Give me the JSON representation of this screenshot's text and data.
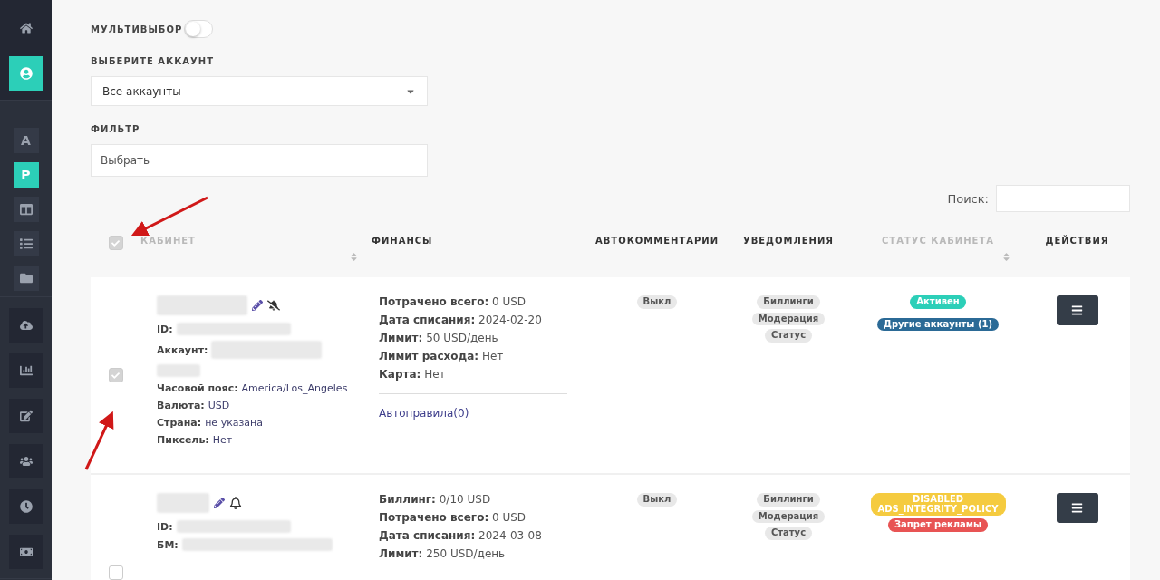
{
  "sidebar": {
    "groups": [
      {
        "kind": "large",
        "items": [
          {
            "selected": false
          },
          {
            "selected": true
          }
        ]
      },
      {
        "kind": "small",
        "items": [
          {
            "letter": "A",
            "selected": false
          },
          {
            "letter": "P",
            "selected": true
          },
          {
            "selected": false
          },
          {
            "selected": false
          },
          {
            "selected": false
          }
        ]
      },
      {
        "kind": "large",
        "items": [
          {
            "selected": false
          },
          {
            "selected": false
          },
          {
            "selected": false
          },
          {
            "selected": false
          },
          {
            "selected": false
          },
          {
            "selected": false
          }
        ]
      }
    ]
  },
  "multiselect": {
    "label": "МУЛЬТИВЫБОР",
    "on": false
  },
  "account_select": {
    "label": "ВЫБЕРИТЕ АККАУНТ",
    "value": "Все аккаунты"
  },
  "filter": {
    "label": "ФИЛЬТР",
    "placeholder": "Выбрать"
  },
  "search": {
    "label": "Поиск:"
  },
  "table": {
    "select_all_checked": true,
    "columns": [
      {
        "label": "КАБИНЕТ",
        "sortable": true
      },
      {
        "label": "ФИНАНСЫ",
        "sortable": false
      },
      {
        "label": "АВТОКОММЕНТАРИИ",
        "sortable": false
      },
      {
        "label": "УВЕДОМЛЕНИЯ",
        "sortable": false
      },
      {
        "label": "СТАТУС КАБИНЕТА",
        "sortable": true
      },
      {
        "label": "ДЕЙСТВИЯ",
        "sortable": false
      }
    ],
    "rows": [
      {
        "checked": true,
        "notifications_muted": true,
        "fields": [
          {
            "kind": "redacted",
            "label": "ID:"
          },
          {
            "kind": "redacted_long",
            "label": "Аккаунт:"
          },
          {
            "kind": "text",
            "label": "Часовой пояс:",
            "value": "America/Los_Angeles"
          },
          {
            "kind": "text",
            "label": "Валюта:",
            "value": "USD"
          },
          {
            "kind": "text",
            "label": "Страна:",
            "value": "не указана"
          },
          {
            "kind": "text",
            "label": "Пиксель:",
            "value": "Нет"
          }
        ],
        "finance": [
          {
            "label": "Потрачено всего:",
            "value": "0 USD"
          },
          {
            "label": "Дата списания:",
            "value": "2024-02-20"
          },
          {
            "label": "Лимит:",
            "value": "50 USD/день"
          },
          {
            "label": "Лимит расхода:",
            "value": "Нет"
          },
          {
            "label": "Карта:",
            "value": "Нет"
          }
        ],
        "autorules": "Автоправила(0)",
        "autocomments": "Выкл",
        "notifications": [
          "Биллинги",
          "Модерация",
          "Статус"
        ],
        "status": [
          {
            "text": "Активен",
            "color": "#2ccfb8"
          },
          {
            "text": "Другие аккаунты (1)",
            "color": "#2b6a96"
          }
        ]
      },
      {
        "checked": false,
        "notifications_muted": false,
        "fields": [
          {
            "kind": "redacted",
            "label": "ID:"
          },
          {
            "kind": "redacted",
            "label": "БМ:"
          }
        ],
        "finance": [
          {
            "label": "Биллинг:",
            "value": "0/10 USD"
          },
          {
            "label": "Потрачено всего:",
            "value": "0 USD"
          },
          {
            "label": "Дата списания:",
            "value": "2024-03-08"
          },
          {
            "label": "Лимит:",
            "value": "250 USD/день"
          }
        ],
        "autocomments": "Выкл",
        "notifications": [
          "Биллинги",
          "Модерация",
          "Статус"
        ],
        "status": [
          {
            "text": "DISABLED ADS_INTEGRITY_POLICY",
            "color": "#f5cb3f"
          },
          {
            "text": "Запрет рекламы",
            "color": "#e85454"
          }
        ]
      }
    ]
  }
}
